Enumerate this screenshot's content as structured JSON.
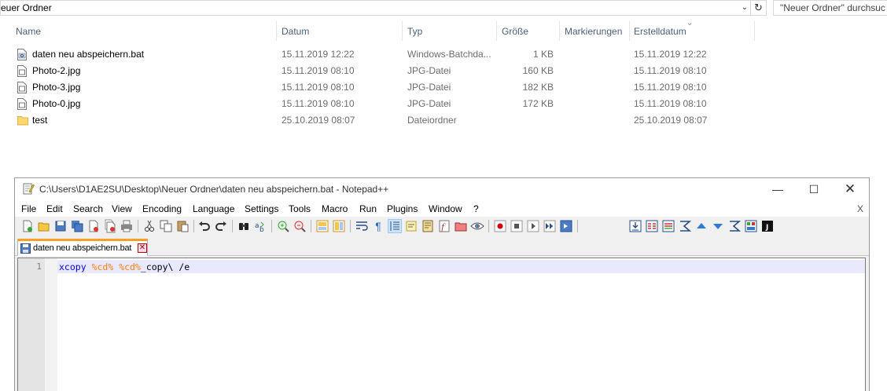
{
  "explorer": {
    "address": "euer Ordner",
    "search_placeholder": "\"Neuer Ordner\" durchsuc",
    "columns": {
      "name": "Name",
      "date": "Datum",
      "type": "Typ",
      "size": "Größe",
      "tags": "Markierungen",
      "created": "Erstelldatum"
    },
    "files": [
      {
        "name": "daten neu abspeichern.bat",
        "date": "15.11.2019 12:22",
        "type": "Windows-Batchda...",
        "size": "1 KB",
        "created": "15.11.2019 12:22",
        "icon": "batch-file-icon"
      },
      {
        "name": "Photo-2.jpg",
        "date": "15.11.2019 08:10",
        "type": "JPG-Datei",
        "size": "160 KB",
        "created": "15.11.2019 08:10",
        "icon": "jpg-file-icon"
      },
      {
        "name": "Photo-3.jpg",
        "date": "15.11.2019 08:10",
        "type": "JPG-Datei",
        "size": "182 KB",
        "created": "15.11.2019 08:10",
        "icon": "jpg-file-icon"
      },
      {
        "name": "Photo-0.jpg",
        "date": "15.11.2019 08:10",
        "type": "JPG-Datei",
        "size": "172 KB",
        "created": "15.11.2019 08:10",
        "icon": "jpg-file-icon"
      },
      {
        "name": "test",
        "date": "25.10.2019 08:07",
        "type": "Dateiordner",
        "size": "",
        "created": "25.10.2019 08:07",
        "icon": "folder-icon"
      }
    ]
  },
  "notepad": {
    "title": "C:\\Users\\D1AE2SU\\Desktop\\Neuer Ordner\\daten neu abspeichern.bat - Notepad++",
    "menu": [
      "File",
      "Edit",
      "Search",
      "View",
      "Encoding",
      "Language",
      "Settings",
      "Tools",
      "Macro",
      "Run",
      "Plugins",
      "Window",
      "?"
    ],
    "menu_close": "X",
    "tab_label": "daten neu abspeichern.bat",
    "line_number": "1",
    "code": {
      "command": "xcopy",
      "var1": "%cd%",
      "var2": "%cd%",
      "rest": "_copy\\ /e"
    },
    "accent_color": "#fa9f25"
  }
}
